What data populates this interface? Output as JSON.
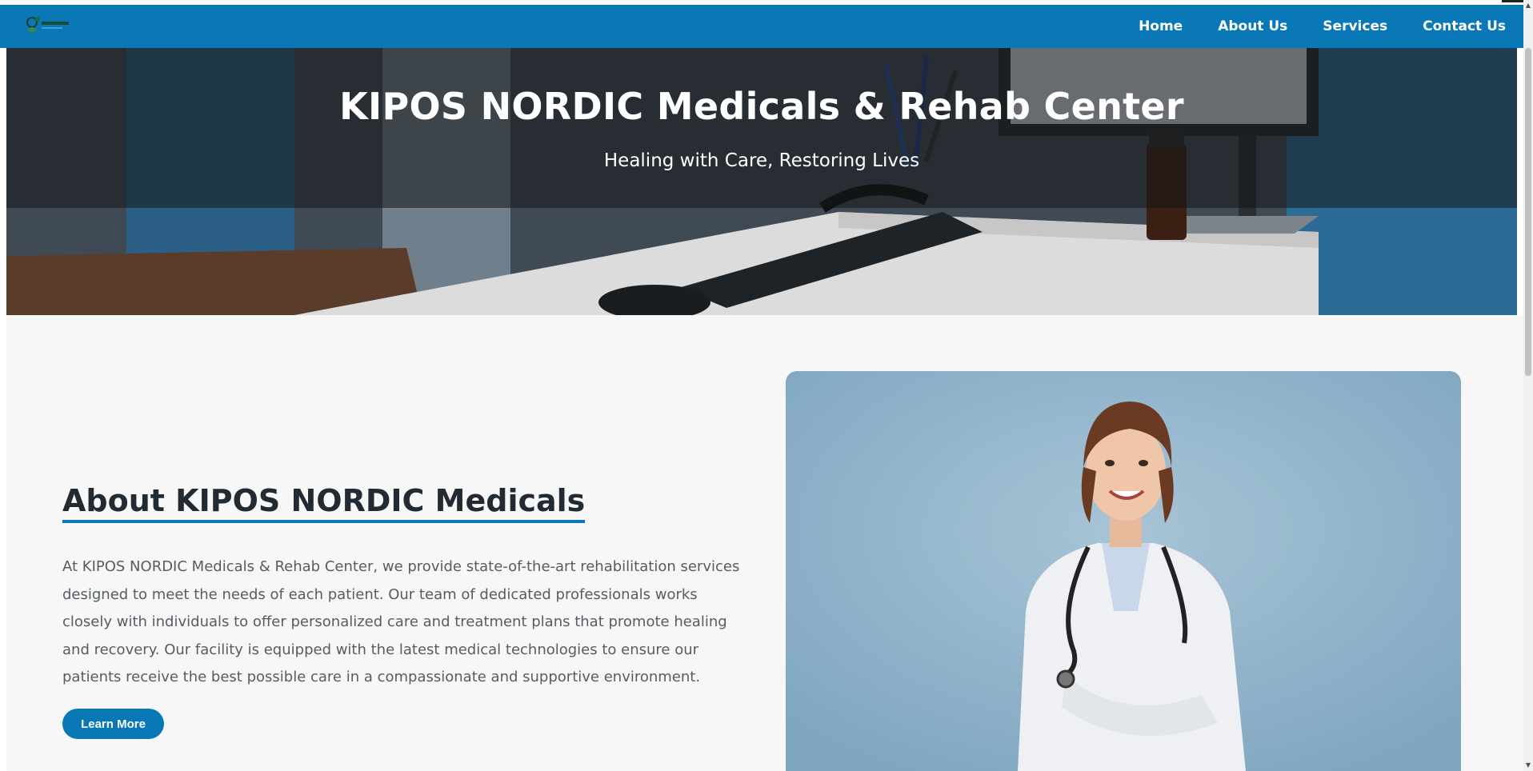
{
  "nav": {
    "logo_alt": "KIPOS NORDIC logo",
    "items": [
      {
        "label": "Home"
      },
      {
        "label": "About Us"
      },
      {
        "label": "Services"
      },
      {
        "label": "Contact Us"
      }
    ],
    "bg_color": "#0a78b6"
  },
  "hero": {
    "title": "KIPOS NORDIC Medicals & Rehab Center",
    "subtitle": "Healing with Care, Restoring Lives"
  },
  "about": {
    "title": "About KIPOS NORDIC Medicals",
    "paragraph": "At KIPOS NORDIC Medicals & Rehab Center, we provide state-of-the-art rehabilitation services designed to meet the needs of each patient. Our team of dedicated professionals works closely with individuals to offer personalized care and treatment plans that promote healing and recovery. Our facility is equipped with the latest medical technologies to ensure our patients receive the best possible care in a compassionate and supportive environment.",
    "button_label": "Learn More",
    "accent_color": "#0a78b6"
  },
  "scrollbar": {
    "up_arrow": "▲",
    "down_arrow": "▼"
  }
}
